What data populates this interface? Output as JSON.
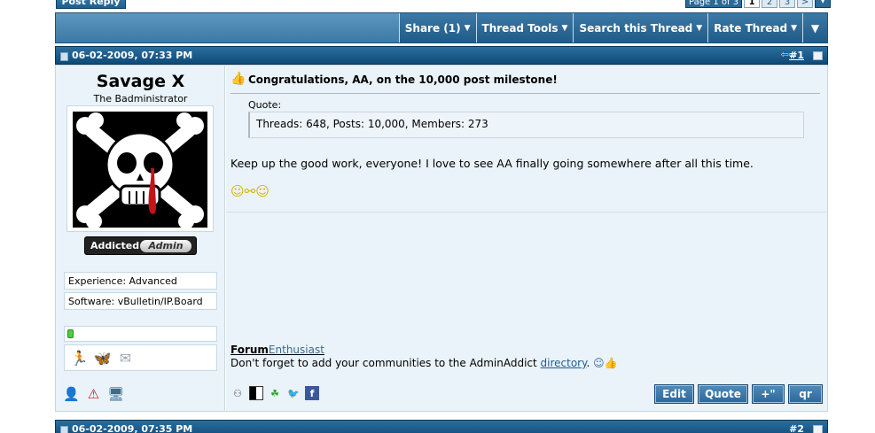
{
  "top": {
    "post_reply_label": "Post Reply",
    "page_label": "Page 1 of 3",
    "pages": [
      "1",
      "2",
      "3"
    ],
    "next_label": ">",
    "dropdown_label": "▾"
  },
  "toolbar": {
    "share_label": "Share (1)",
    "thread_tools_label": "Thread Tools",
    "search_thread_label": "Search this Thread",
    "rate_thread_label": "Rate Thread"
  },
  "post": {
    "date": "06-02-2009, 07:33 PM",
    "number": "#1",
    "nav_icons": "⇦⇨",
    "title_icon": "thumbs-up-icon",
    "title": "Congratulations, AA, on the 10,000 post milestone!",
    "quote_label": "Quote:",
    "quote_text": "Threads: 648, Posts: 10,000, Members: 273",
    "message": "Keep up the good work, everyone! I love to see AA finally going somewhere after all this time.",
    "smilies": "☺⚯☺"
  },
  "user": {
    "name": "Savage X",
    "title": "The Badministrator",
    "rank_left": "Addicted",
    "rank_right": "Admin",
    "experience": "Experience: Advanced",
    "software": "Software: vBulletin/IP.Board",
    "reputation_fraction": 0.04
  },
  "signature": {
    "title_bold": "Forum",
    "title_rest": "Enthusiast",
    "line_text": "Don't forget to add your communities to the AdminAddict ",
    "link_text": "directory",
    "line_end": "."
  },
  "actions": {
    "edit_label": "Edit",
    "quote_label": "Quote",
    "multiquote_label": "+\"",
    "quick_reply_label": "qr"
  },
  "next_post": {
    "date": "06-02-2009, 07:35 PM",
    "number": "#2"
  },
  "colors": {
    "header_blue": "#0e4a78",
    "toolbar_blue": "#3d79a5",
    "panel_bg": "#eaf3f9",
    "link": "#1f5b8f"
  }
}
